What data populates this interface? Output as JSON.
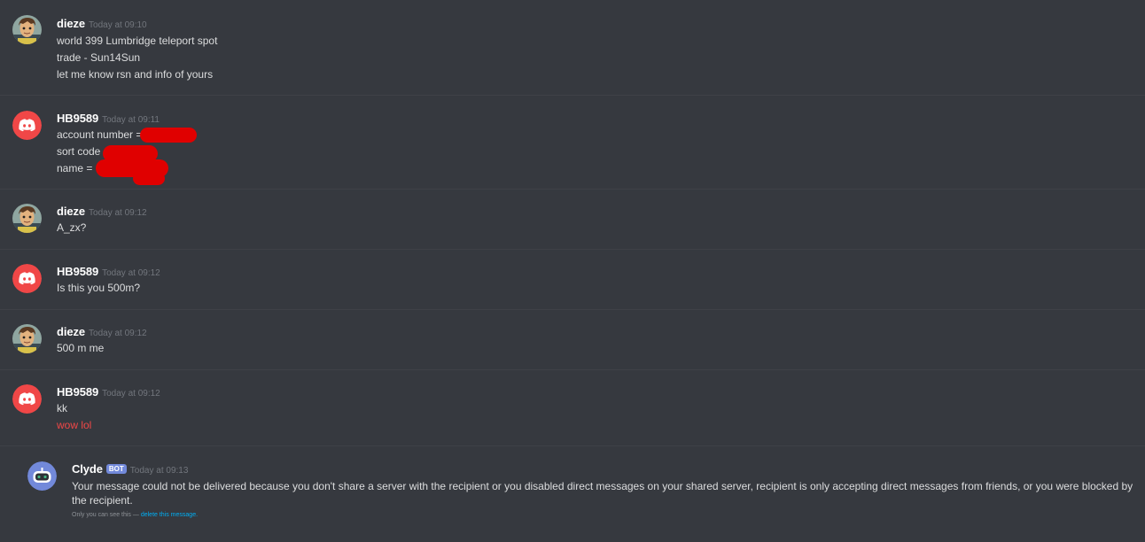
{
  "colors": {
    "background": "#36393f",
    "author": "#ffffff",
    "timestamp": "#72767d",
    "text": "#dcddde",
    "red_text": "#f04747",
    "discord_red_avatar": "#f04747",
    "clyde_avatar_bg": "#7289da",
    "link": "#00aff4",
    "bot_tag": "#7289da"
  },
  "messages": [
    {
      "author": "dieze",
      "timestamp": "Today at 09:10",
      "avatar": "user-portrait-icon",
      "lines": [
        "world 399 Lumbridge teleport spot",
        "trade - Sun14Sun",
        "let me know rsn and info of yours"
      ]
    },
    {
      "author": "HB9589",
      "timestamp": "Today at 09:11",
      "avatar": "discord-logo-icon",
      "lines": [
        "account number =",
        "sort code",
        "name ="
      ]
    },
    {
      "author": "dieze",
      "timestamp": "Today at 09:12",
      "avatar": "user-portrait-icon",
      "lines": [
        "A_zx?"
      ]
    },
    {
      "author": "HB9589",
      "timestamp": "Today at 09:12",
      "avatar": "discord-logo-icon",
      "lines": [
        "Is this you 500m?"
      ]
    },
    {
      "author": "dieze",
      "timestamp": "Today at 09:12",
      "avatar": "user-portrait-icon",
      "lines": [
        "500 m me"
      ]
    },
    {
      "author": "HB9589",
      "timestamp": "Today at 09:12",
      "avatar": "discord-logo-icon",
      "lines": [
        "kk"
      ],
      "red_line": "wow lol"
    }
  ],
  "clyde": {
    "author": "Clyde",
    "bot_tag": "BOT",
    "timestamp": "Today at 09:13",
    "avatar": "clyde-bot-icon",
    "body": "Your message could not be delivered because you don't share a server with the recipient or you disabled direct messages on your shared server, recipient is only accepting direct messages from friends, or you were blocked by the recipient.",
    "note_prefix": "Only you can see this —",
    "note_link": "delete this message."
  }
}
